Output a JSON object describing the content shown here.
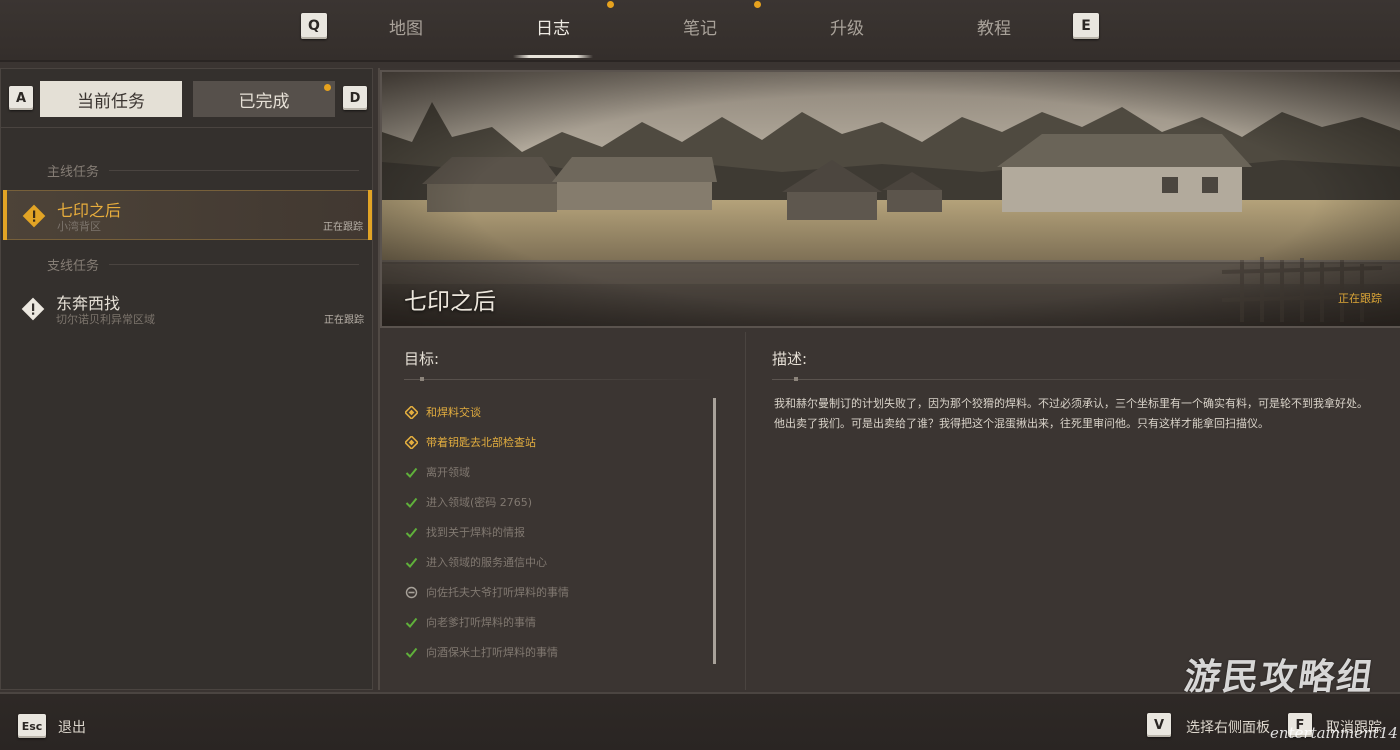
{
  "nav": {
    "left_key": "Q",
    "right_key": "E",
    "tabs": [
      {
        "label": "地图"
      },
      {
        "label": "日志"
      },
      {
        "label": "笔记"
      },
      {
        "label": "升级"
      },
      {
        "label": "教程"
      }
    ],
    "active_tab": "日志",
    "notification_color": "#e6a21e"
  },
  "quests": {
    "prev_key": "A",
    "next_key": "D",
    "tab_current": "当前任务",
    "tab_completed": "已完成",
    "main_section": "主线任务",
    "side_section": "支线任务",
    "main": [
      {
        "title": "七印之后",
        "region": "小湾背区",
        "status": "正在跟踪",
        "icon": "warning-diamond-icon",
        "selected": true
      }
    ],
    "side": [
      {
        "title": "东奔西找",
        "region": "切尔诺贝利异常区域",
        "status": "正在跟踪",
        "icon": "warning-diamond-icon",
        "selected": false
      }
    ],
    "accent_color": "#e2a425"
  },
  "detail": {
    "title": "七印之后",
    "status": "正在跟踪",
    "objectives_heading": "目标:",
    "description_heading": "描述:",
    "objectives": [
      {
        "text": "和焊料交谈",
        "state": "active",
        "icon": "diamond-target-icon"
      },
      {
        "text": "带着钥匙去北部检查站",
        "state": "active",
        "icon": "diamond-target-icon"
      },
      {
        "text": "离开领域",
        "state": "done",
        "icon": "check-icon"
      },
      {
        "text": "进入领域(密码 2765)",
        "state": "done",
        "icon": "check-icon"
      },
      {
        "text": "找到关于焊料的情报",
        "state": "done",
        "icon": "check-icon"
      },
      {
        "text": "进入领域的服务通信中心",
        "state": "done",
        "icon": "check-icon"
      },
      {
        "text": "向佐托夫大爷打听焊料的事情",
        "state": "failed",
        "icon": "minus-circle-icon"
      },
      {
        "text": "向老爹打听焊料的事情",
        "state": "done",
        "icon": "check-icon"
      },
      {
        "text": "向酒保米土打听焊料的事情",
        "state": "done",
        "icon": "check-icon"
      }
    ],
    "description_lines": [
      "我和赫尔曼制订的计划失败了，因为那个狡猾的焊料。不过必须承认，三个坐标里有一个确实有料，可是轮不到我拿好处。",
      "他出卖了我们。可是出卖给了谁？我得把这个混蛋揪出来，往死里审问他。只有这样才能拿回扫描仪。"
    ]
  },
  "bottom": {
    "exit_key": "Esc",
    "exit_label": "退出",
    "select_key": "V",
    "select_label": "选择右侧面板",
    "untrack_key": "F",
    "untrack_label": "取消跟踪"
  },
  "watermark": {
    "main": "游民攻略组",
    "sub": "entertainment14"
  }
}
